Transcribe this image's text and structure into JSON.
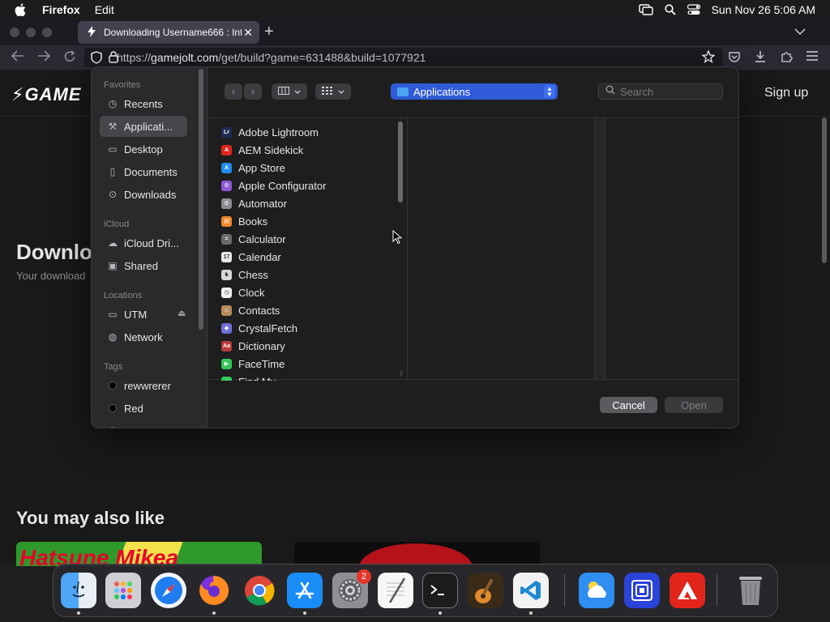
{
  "menubar": {
    "app_name": "Firefox",
    "menu_items": [
      "Edit"
    ],
    "clock": "Sun Nov 26  5:06 AM"
  },
  "browser": {
    "tab_title": "Downloading Username666 : Int",
    "url_prefix": "https://",
    "url_host": "gamejolt.com",
    "url_path": "/get/build?game=631488&build=1077921"
  },
  "site": {
    "logo": "GAME",
    "signup": "Sign up",
    "heading": "Downloa",
    "subtext": "Your download",
    "also_like": "You may also like",
    "thumb1_text": "Hatsune Mikea"
  },
  "dialog": {
    "sidebar": {
      "favorites_heading": "Favorites",
      "favorites": [
        "Recents",
        "Applicati...",
        "Desktop",
        "Documents",
        "Downloads"
      ],
      "icloud_heading": "iCloud",
      "icloud": [
        "iCloud Dri...",
        "Shared"
      ],
      "locations_heading": "Locations",
      "locations": [
        "UTM",
        "Network"
      ],
      "tags_heading": "Tags",
      "tags": [
        "rewwrerer",
        "Red",
        "O"
      ]
    },
    "location": "Applications",
    "search_placeholder": "Search",
    "files": [
      {
        "name": "Adobe Lightroom",
        "color": "#1d2c56",
        "glyph": "Lr"
      },
      {
        "name": "AEM Sidekick",
        "color": "#e1251b",
        "glyph": "A"
      },
      {
        "name": "App Store",
        "color": "#1e8ef0",
        "glyph": "A"
      },
      {
        "name": "Apple Configurator",
        "color": "#8e59d8",
        "glyph": "⚙"
      },
      {
        "name": "Automator",
        "color": "#8c8c92",
        "glyph": "⚙"
      },
      {
        "name": "Books",
        "color": "#f0872b",
        "glyph": "▤"
      },
      {
        "name": "Calculator",
        "color": "#6b6b70",
        "glyph": "="
      },
      {
        "name": "Calendar",
        "color": "#e9e9ea",
        "glyph": "17"
      },
      {
        "name": "Chess",
        "color": "#d8d8da",
        "glyph": "♞"
      },
      {
        "name": "Clock",
        "color": "#f2f2f2",
        "glyph": "◷"
      },
      {
        "name": "Contacts",
        "color": "#b88a5a",
        "glyph": "☺"
      },
      {
        "name": "CrystalFetch",
        "color": "#6f6fd8",
        "glyph": "◆"
      },
      {
        "name": "Dictionary",
        "color": "#b83a3a",
        "glyph": "Aa"
      },
      {
        "name": "FaceTime",
        "color": "#34c759",
        "glyph": "▶"
      },
      {
        "name": "Find My",
        "color": "#34c759",
        "glyph": "●"
      }
    ],
    "cancel_label": "Cancel",
    "open_label": "Open"
  },
  "dock": {
    "settings_badge": "2"
  },
  "colors": {
    "accent": "#2f5bd8",
    "dialog_bg": "#1e1e1e",
    "sidebar_bg": "#2a2a2c"
  }
}
